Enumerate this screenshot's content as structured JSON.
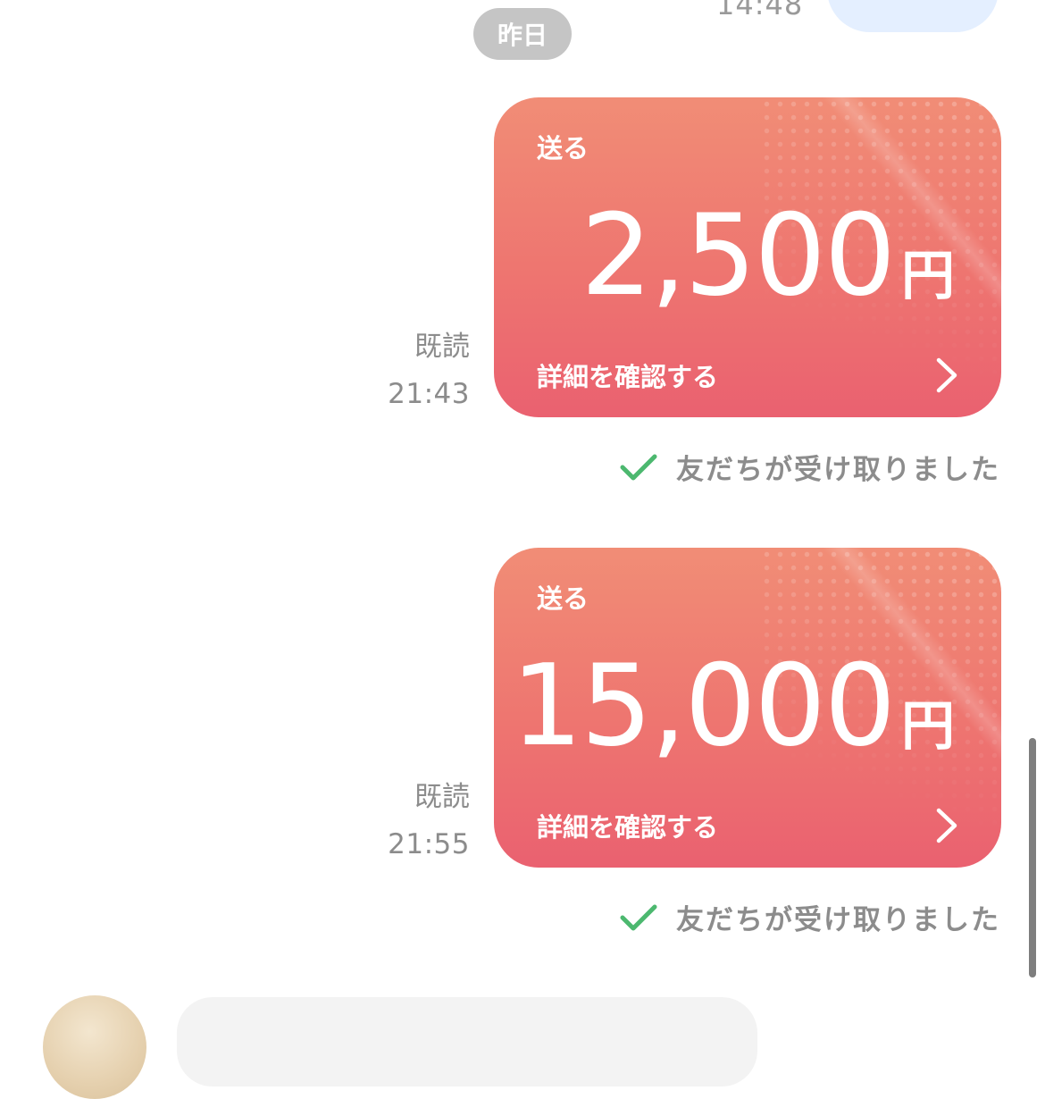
{
  "header": {
    "previous_time": "14:48",
    "date_separator": "昨日"
  },
  "messages": [
    {
      "read_status": "既読",
      "time": "21:43",
      "card": {
        "label": "送る",
        "amount": "2,500",
        "currency": "円",
        "details_label": "詳細を確認する"
      },
      "received_status": "友だちが受け取りました"
    },
    {
      "read_status": "既読",
      "time": "21:55",
      "card": {
        "label": "送る",
        "amount": "15,000",
        "currency": "円",
        "details_label": "詳細を確認する"
      },
      "received_status": "友だちが受け取りました"
    }
  ],
  "icons": {
    "chevron": "chevron-right-icon",
    "received_check": "check-icon"
  },
  "colors": {
    "card_top": "#f18d76",
    "card_bottom": "#ea6170",
    "check_green": "#4cb86f",
    "date_pill": "#c5c5c5",
    "meta_text": "#8c8c8c"
  }
}
